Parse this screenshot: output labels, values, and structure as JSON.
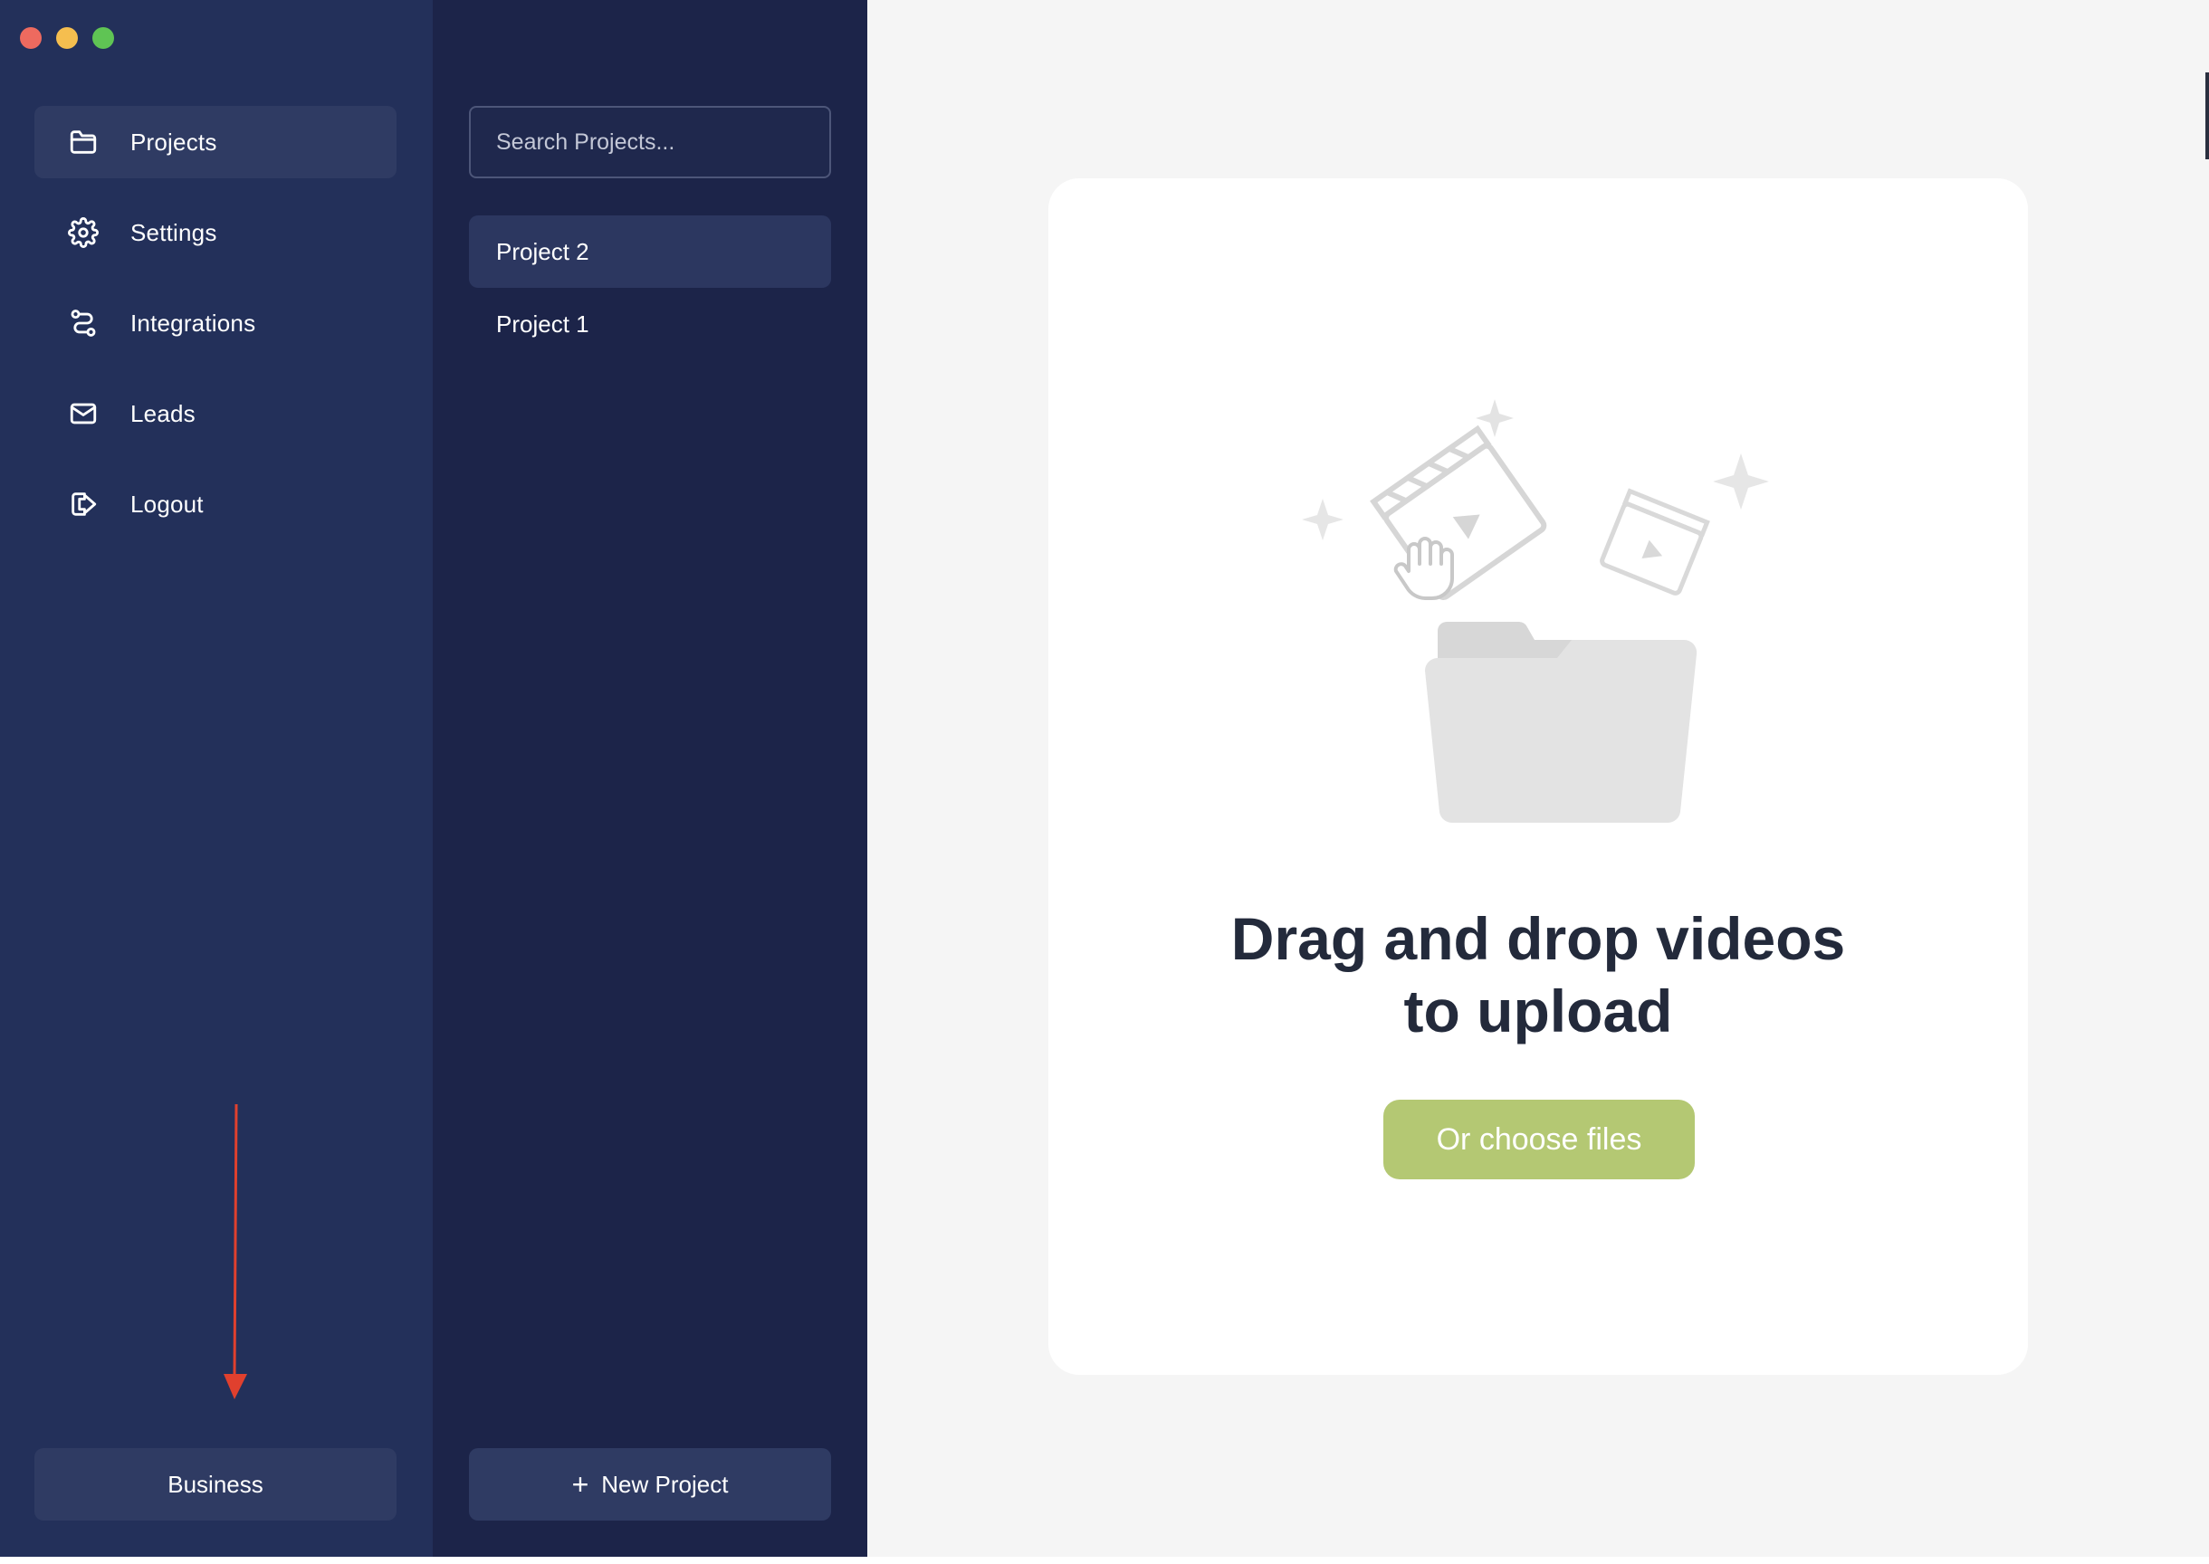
{
  "window": {
    "traffic_lights": [
      "close",
      "minimize",
      "maximize"
    ]
  },
  "sidebar": {
    "items": [
      {
        "label": "Projects",
        "icon": "folder-icon",
        "active": true
      },
      {
        "label": "Settings",
        "icon": "gear-icon",
        "active": false
      },
      {
        "label": "Integrations",
        "icon": "route-icon",
        "active": false
      },
      {
        "label": "Leads",
        "icon": "mail-icon",
        "active": false
      },
      {
        "label": "Logout",
        "icon": "logout-icon",
        "active": false
      }
    ],
    "business_label": "Business"
  },
  "projects": {
    "search_placeholder": "Search Projects...",
    "items": [
      {
        "label": "Project 2",
        "active": true
      },
      {
        "label": "Project 1",
        "active": false
      }
    ],
    "new_project_label": "New Project",
    "new_project_icon": "plus-icon"
  },
  "main": {
    "headline_line1": "Drag and drop videos",
    "headline_line2": "to upload",
    "choose_files_label": "Or choose files"
  },
  "colors": {
    "sidebar_bg": "#23305a",
    "projects_bg": "#1c2449",
    "accent_green": "#b4c873",
    "annotation_arrow": "#e0402e"
  }
}
